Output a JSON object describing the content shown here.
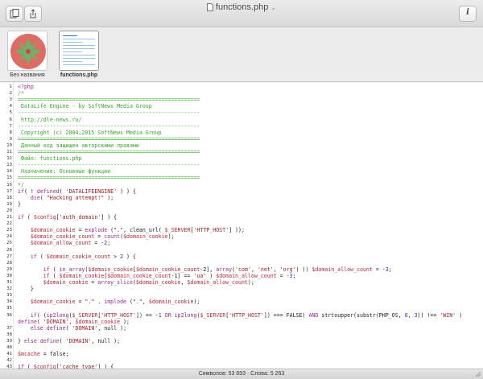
{
  "window": {
    "title": "functions.php"
  },
  "toolbar": {
    "left_buttons": [
      {
        "icon": "documents-icon"
      },
      {
        "icon": "share-icon"
      }
    ],
    "right_button": {
      "icon": "info-icon",
      "label": "i"
    }
  },
  "shelf": {
    "items": [
      {
        "caption": "Без названия",
        "icon": "rose-image-icon",
        "selected": false
      },
      {
        "caption": "functions.php",
        "icon": "document-thumbnail-icon",
        "selected": true
      }
    ]
  },
  "editor": {
    "lines": [
      {
        "n": "1",
        "parts": [
          [
            "kw",
            "<?php"
          ]
        ]
      },
      {
        "n": "2",
        "parts": [
          [
            "cmt",
            "/*"
          ]
        ]
      },
      {
        "n": "3",
        "parts": [
          [
            "cmt",
            "========================================================="
          ]
        ]
      },
      {
        "n": "4",
        "parts": [
          [
            "cmt",
            " DataLife Engine - by SoftNews Media Group"
          ]
        ]
      },
      {
        "n": "5",
        "parts": [
          [
            "cmt",
            "---------------------------------------------------------"
          ]
        ]
      },
      {
        "n": "6",
        "parts": [
          [
            "cmt",
            " http://dle-news.ru/"
          ]
        ]
      },
      {
        "n": "7",
        "parts": [
          [
            "cmt",
            "---------------------------------------------------------"
          ]
        ]
      },
      {
        "n": "8",
        "parts": [
          [
            "cmt",
            " Copyright (c) 2004,2015 SoftNews Media Group"
          ]
        ]
      },
      {
        "n": "9",
        "parts": [
          [
            "cmt",
            "========================================================="
          ]
        ]
      },
      {
        "n": "10",
        "parts": [
          [
            "cmt",
            " Данный код защищен авторскими правами"
          ]
        ]
      },
      {
        "n": "11",
        "parts": [
          [
            "cmt",
            "========================================================="
          ]
        ]
      },
      {
        "n": "12",
        "parts": [
          [
            "cmt",
            " Файл: functions.php"
          ]
        ]
      },
      {
        "n": "13",
        "parts": [
          [
            "cmt",
            "---------------------------------------------------------"
          ]
        ]
      },
      {
        "n": "14",
        "parts": [
          [
            "cmt",
            " Назначение: Основные функции"
          ]
        ]
      },
      {
        "n": "15",
        "parts": [
          [
            "cmt",
            "========================================================="
          ]
        ]
      },
      {
        "n": "16",
        "parts": [
          [
            "cmt",
            "*/"
          ]
        ]
      },
      {
        "n": "17",
        "parts": [
          [
            "kw",
            "if"
          ],
          [
            "fn",
            "( ! "
          ],
          [
            "kw",
            "defined"
          ],
          [
            "fn",
            "( "
          ],
          [
            "str",
            "'DATALIFEENGINE'"
          ],
          [
            "fn",
            " ) ) {"
          ]
        ]
      },
      {
        "n": "18",
        "parts": [
          [
            "fn",
            "    "
          ],
          [
            "kw",
            "die"
          ],
          [
            "fn",
            "( "
          ],
          [
            "str",
            "\"Hacking attempt!\""
          ],
          [
            "fn",
            " );"
          ]
        ]
      },
      {
        "n": "19",
        "parts": [
          [
            "fn",
            "}"
          ]
        ]
      },
      {
        "n": "20",
        "parts": [
          [
            "fn",
            ""
          ]
        ]
      },
      {
        "n": "21",
        "parts": [
          [
            "kw",
            "if"
          ],
          [
            "fn",
            " ( "
          ],
          [
            "var",
            "$config"
          ],
          [
            "fn",
            "["
          ],
          [
            "str",
            "'auth_domain'"
          ],
          [
            "fn",
            "] ) {"
          ]
        ]
      },
      {
        "n": "22",
        "parts": [
          [
            "fn",
            ""
          ]
        ]
      },
      {
        "n": "23",
        "parts": [
          [
            "fn",
            "    "
          ],
          [
            "var",
            "$domain_cookie"
          ],
          [
            "fn",
            " = "
          ],
          [
            "kw",
            "explode"
          ],
          [
            "fn",
            " ("
          ],
          [
            "str",
            "\".\""
          ],
          [
            "fn",
            ", clean_url( "
          ],
          [
            "var",
            "$_SERVER"
          ],
          [
            "fn",
            "["
          ],
          [
            "str",
            "'HTTP_HOST'"
          ],
          [
            "fn",
            "] ));"
          ]
        ]
      },
      {
        "n": "24",
        "parts": [
          [
            "fn",
            "    "
          ],
          [
            "var",
            "$domain_cookie_count"
          ],
          [
            "fn",
            " = "
          ],
          [
            "kw",
            "count"
          ],
          [
            "fn",
            "("
          ],
          [
            "var",
            "$domain_cookie"
          ],
          [
            "fn",
            ");"
          ]
        ]
      },
      {
        "n": "25",
        "parts": [
          [
            "fn",
            "    "
          ],
          [
            "var",
            "$domain_allow_count"
          ],
          [
            "fn",
            " = -"
          ],
          [
            "num",
            "2"
          ],
          [
            "fn",
            ";"
          ]
        ]
      },
      {
        "n": "26",
        "parts": [
          [
            "fn",
            ""
          ]
        ]
      },
      {
        "n": "27",
        "parts": [
          [
            "fn",
            "    "
          ],
          [
            "kw",
            "if"
          ],
          [
            "fn",
            " ( "
          ],
          [
            "var",
            "$domain_cookie_count"
          ],
          [
            "fn",
            " > "
          ],
          [
            "num",
            "2"
          ],
          [
            "fn",
            " ) {"
          ]
        ]
      },
      {
        "n": "28",
        "parts": [
          [
            "fn",
            ""
          ]
        ]
      },
      {
        "n": "29",
        "parts": [
          [
            "fn",
            "        "
          ],
          [
            "kw",
            "if"
          ],
          [
            "fn",
            " ( "
          ],
          [
            "kw",
            "in_array"
          ],
          [
            "fn",
            "("
          ],
          [
            "var",
            "$domain_cookie"
          ],
          [
            "fn",
            "["
          ],
          [
            "var",
            "$domain_cookie_count"
          ],
          [
            "fn",
            "-2], "
          ],
          [
            "kw",
            "array"
          ],
          [
            "fn",
            "("
          ],
          [
            "str",
            "'com'"
          ],
          [
            "fn",
            ", "
          ],
          [
            "str",
            "'net'"
          ],
          [
            "fn",
            ", "
          ],
          [
            "str",
            "'org'"
          ],
          [
            "fn",
            ") )) "
          ],
          [
            "var",
            "$domain_allow_count"
          ],
          [
            "fn",
            " = -"
          ],
          [
            "num",
            "3"
          ],
          [
            "fn",
            ";"
          ]
        ]
      },
      {
        "n": "30",
        "parts": [
          [
            "fn",
            "        "
          ],
          [
            "kw",
            "if"
          ],
          [
            "fn",
            " ( "
          ],
          [
            "var",
            "$domain_cookie"
          ],
          [
            "fn",
            "["
          ],
          [
            "var",
            "$domain_cookie_count"
          ],
          [
            "fn",
            "-1] == "
          ],
          [
            "str",
            "'ua'"
          ],
          [
            "fn",
            " ) "
          ],
          [
            "var",
            "$domain_allow_count"
          ],
          [
            "fn",
            " = -"
          ],
          [
            "num",
            "3"
          ],
          [
            "fn",
            ";"
          ]
        ]
      },
      {
        "n": "31",
        "parts": [
          [
            "fn",
            "        "
          ],
          [
            "var",
            "$domain_cookie"
          ],
          [
            "fn",
            " = "
          ],
          [
            "kw",
            "array_slice"
          ],
          [
            "fn",
            "("
          ],
          [
            "var",
            "$domain_cookie"
          ],
          [
            "fn",
            ", "
          ],
          [
            "var",
            "$domain_allow_count"
          ],
          [
            "fn",
            ");"
          ]
        ]
      },
      {
        "n": "32",
        "parts": [
          [
            "fn",
            "    }"
          ]
        ]
      },
      {
        "n": "33",
        "parts": [
          [
            "fn",
            ""
          ]
        ]
      },
      {
        "n": "34",
        "parts": [
          [
            "fn",
            "    "
          ],
          [
            "var",
            "$domain_cookie"
          ],
          [
            "fn",
            " = "
          ],
          [
            "str",
            "\".\""
          ],
          [
            "fn",
            " . "
          ],
          [
            "kw",
            "implode"
          ],
          [
            "fn",
            " ("
          ],
          [
            "str",
            "\".\""
          ],
          [
            "fn",
            ", "
          ],
          [
            "var",
            "$domain_cookie"
          ],
          [
            "fn",
            ");"
          ]
        ]
      },
      {
        "n": "35",
        "parts": [
          [
            "fn",
            ""
          ]
        ]
      },
      {
        "n": "36",
        "parts": [
          [
            "fn",
            "    "
          ],
          [
            "kw",
            "if"
          ],
          [
            "fn",
            "( ("
          ],
          [
            "kw",
            "ip2long"
          ],
          [
            "fn",
            "("
          ],
          [
            "var",
            "$_SERVER"
          ],
          [
            "fn",
            "["
          ],
          [
            "str",
            "'HTTP_HOST'"
          ],
          [
            "fn",
            "]) == -"
          ],
          [
            "num",
            "1"
          ],
          [
            "fn",
            " "
          ],
          [
            "kw",
            "OR"
          ],
          [
            "fn",
            " "
          ],
          [
            "kw",
            "ip2long"
          ],
          [
            "fn",
            "("
          ],
          [
            "var",
            "$_SERVER"
          ],
          [
            "fn",
            "["
          ],
          [
            "str",
            "'HTTP_HOST'"
          ],
          [
            "fn",
            "]) === FALSE) "
          ],
          [
            "kw",
            "AND"
          ],
          [
            "fn",
            " strtoupper(substr(PHP_OS, "
          ],
          [
            "num",
            "0"
          ],
          [
            "fn",
            ", "
          ],
          [
            "num",
            "3"
          ],
          [
            "fn",
            ")) !== "
          ],
          [
            "str",
            "'WIN'"
          ],
          [
            "fn",
            " )"
          ]
        ]
      },
      {
        "n": "",
        "parts": [
          [
            "kw",
            "define"
          ],
          [
            "fn",
            "( "
          ],
          [
            "str",
            "'DOMAIN'"
          ],
          [
            "fn",
            ", "
          ],
          [
            "var",
            "$domain_cookie"
          ],
          [
            "fn",
            " );"
          ]
        ]
      },
      {
        "n": "37",
        "parts": [
          [
            "fn",
            "    "
          ],
          [
            "kw",
            "else"
          ],
          [
            "fn",
            " "
          ],
          [
            "kw",
            "define"
          ],
          [
            "fn",
            "( "
          ],
          [
            "str",
            "'DOMAIN'"
          ],
          [
            "fn",
            ", null );"
          ]
        ]
      },
      {
        "n": "38",
        "parts": [
          [
            "fn",
            ""
          ]
        ]
      },
      {
        "n": "39",
        "parts": [
          [
            "fn",
            "} "
          ],
          [
            "kw",
            "else"
          ],
          [
            "fn",
            " "
          ],
          [
            "kw",
            "define"
          ],
          [
            "fn",
            "( "
          ],
          [
            "str",
            "'DOMAIN'"
          ],
          [
            "fn",
            ", null );"
          ]
        ]
      },
      {
        "n": "40",
        "parts": [
          [
            "fn",
            ""
          ]
        ]
      },
      {
        "n": "41",
        "parts": [
          [
            "var",
            "$mcache"
          ],
          [
            "fn",
            " = false;"
          ]
        ]
      },
      {
        "n": "42",
        "parts": [
          [
            "fn",
            ""
          ]
        ]
      },
      {
        "n": "43",
        "parts": [
          [
            "kw",
            "if"
          ],
          [
            "fn",
            " ( "
          ],
          [
            "var",
            "$config"
          ],
          [
            "fn",
            "["
          ],
          [
            "str",
            "'cache_type'"
          ],
          [
            "fn",
            "] ) {"
          ]
        ]
      },
      {
        "n": "44",
        "parts": [
          [
            "fn",
            ""
          ]
        ]
      },
      {
        "n": "45",
        "parts": [
          [
            "fn",
            "    "
          ],
          [
            "kw",
            "if"
          ],
          [
            "fn",
            " ( "
          ],
          [
            "kw",
            "function_exists"
          ],
          [
            "fn",
            "("
          ],
          [
            "str",
            "'memcache_connect'"
          ],
          [
            "fn",
            ") ) {"
          ]
        ]
      },
      {
        "n": "46",
        "parts": [
          [
            "fn",
            ""
          ]
        ]
      }
    ]
  },
  "status": {
    "text": "Символов: 53 693 · Слова: 5 263"
  },
  "colors": {
    "comment": "#3aa52c",
    "keyword": "#8f2c8a",
    "variable": "#b02838",
    "string": "#9d1c23"
  }
}
